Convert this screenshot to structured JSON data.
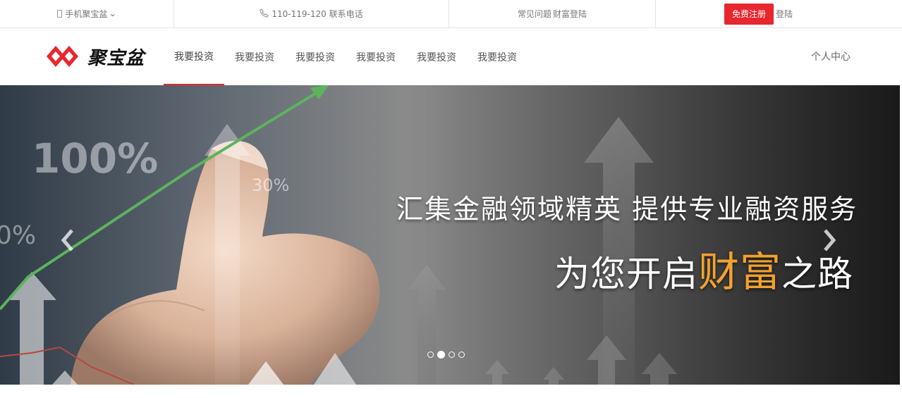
{
  "topbar": {
    "mobile_label": "手机聚宝盆",
    "hotline_label": "110-119-120 联系电话",
    "faq_label": "常见问题",
    "wealth_login_label": "财富登陆",
    "register_label": "免费注册",
    "login_label": "登陆"
  },
  "nav": {
    "logo_text": "聚宝盆",
    "items": [
      {
        "label": "我要投资"
      },
      {
        "label": "我要投资"
      },
      {
        "label": "我要投资"
      },
      {
        "label": "我要投资"
      },
      {
        "label": "我要投资"
      },
      {
        "label": "我要投资"
      }
    ],
    "active_index": 0,
    "user_center_label": "个人中心"
  },
  "banner": {
    "headline_line1": "汇集金融领域精英  提供专业融资服务",
    "headline_line2_prefix": "为您开启",
    "headline_line2_highlight": "财富",
    "headline_line2_suffix": "之路",
    "image_labels": [
      "100%",
      "30%",
      "0%"
    ],
    "slide_count": 4,
    "active_slide": 1
  },
  "colors": {
    "accent": "#e8262e",
    "highlight": "#f3a12f"
  }
}
